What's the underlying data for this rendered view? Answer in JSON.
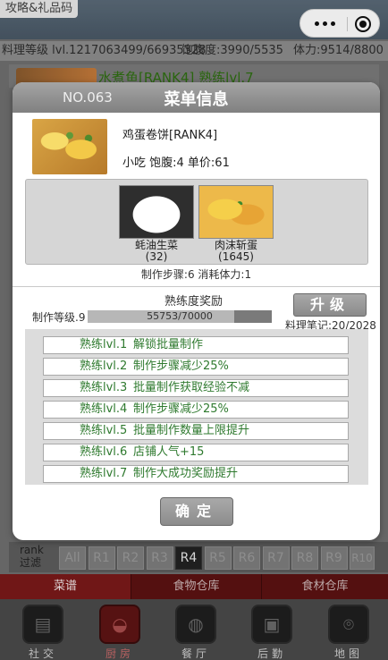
{
  "top": {
    "promo_label": "攻略&礼品码"
  },
  "stats": {
    "cooking_level": "料理等级 lvl.1217063499/66935328",
    "satiety": "饱腹度:3990/5535",
    "stamina": "体力:9514/8800"
  },
  "background_dish": {
    "title": "水煮鱼[RANK4]  熟练lvl.7"
  },
  "modal": {
    "number": "NO.063",
    "title": "菜单信息",
    "dish_name": "鸡蛋卷饼[RANK4]",
    "dish_meta": "小吃 饱腹:4 单价:61",
    "ingredients": [
      {
        "name": "蚝油生菜",
        "count": "(32)",
        "icon": "oyster-lettuce-image"
      },
      {
        "name": "肉沫斩蛋",
        "count": "(1645)",
        "icon": "minced-pork-egg-image"
      }
    ],
    "steps_line": "制作步骤:6 消耗体力:1",
    "proficiency_title": "熟练度奖励",
    "upgrade_label": "升级",
    "make_level": "制作等级.9",
    "progress_text": "55753/70000",
    "progress_fraction": 0.7965,
    "notes": "料理笔记:20/2028",
    "rewards": [
      {
        "level": "熟练lvl.1",
        "desc": "解锁批量制作"
      },
      {
        "level": "熟练lvl.2",
        "desc": "制作步骤减少25%"
      },
      {
        "level": "熟练lvl.3",
        "desc": "批量制作获取经验不减"
      },
      {
        "level": "熟练lvl.4",
        "desc": "制作步骤减少25%"
      },
      {
        "level": "熟练lvl.5",
        "desc": "批量制作数量上限提升"
      },
      {
        "level": "熟练lvl.6",
        "desc": "店铺人气+15"
      },
      {
        "level": "熟练lvl.7",
        "desc": "制作大成功奖励提升"
      }
    ],
    "confirm_label": "确定"
  },
  "rank_filter": {
    "label": "rank 过滤",
    "options": [
      "All",
      "R1",
      "R2",
      "R3",
      "R4",
      "R5",
      "R6",
      "R7",
      "R8",
      "R9",
      "R10"
    ],
    "selected": "R4"
  },
  "sub_tabs": [
    "菜谱",
    "食物仓库",
    "食材仓库"
  ],
  "bottom_nav": [
    {
      "label": "社交",
      "icon": "news-icon"
    },
    {
      "label": "厨房",
      "icon": "pot-icon",
      "active": true
    },
    {
      "label": "餐厅",
      "icon": "utensils-icon"
    },
    {
      "label": "后勤",
      "icon": "logistics-icon"
    },
    {
      "label": "地图",
      "icon": "map-pin-icon"
    }
  ],
  "colors": {
    "reward_text": "#2f7a2f",
    "active_tab": "#7a1a1a",
    "header_gray": "#8c8c8c"
  }
}
